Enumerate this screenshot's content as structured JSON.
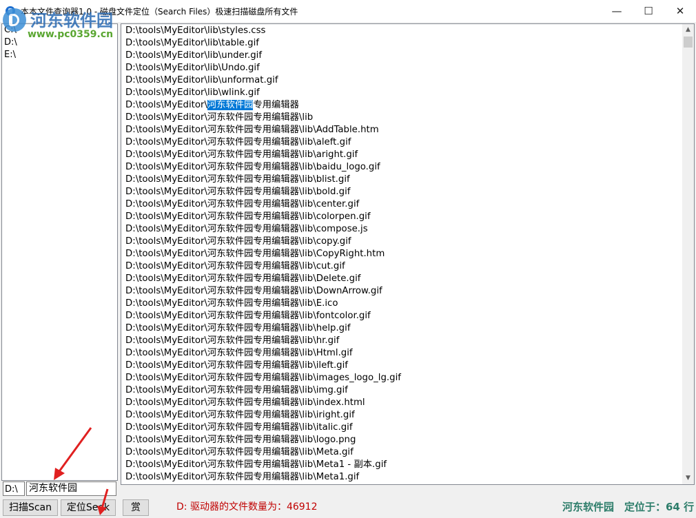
{
  "window": {
    "title": "本本文件查询器1.0 - 磁盘文件定位（Search Files）极速扫描磁盘所有文件",
    "minimize_label": "—",
    "maximize_label": "☐",
    "close_label": "✕"
  },
  "watermark": {
    "name": "河东软件园",
    "url": "www.pc0359.cn"
  },
  "drives": [
    "C:\\",
    "D:\\",
    "E:\\"
  ],
  "files": {
    "selected_text": "河东软件园",
    "rows": [
      "D:\\tools\\MyEditor\\lib\\styles.css",
      "D:\\tools\\MyEditor\\lib\\table.gif",
      "D:\\tools\\MyEditor\\lib\\under.gif",
      "D:\\tools\\MyEditor\\lib\\Undo.gif",
      "D:\\tools\\MyEditor\\lib\\unformat.gif",
      "D:\\tools\\MyEditor\\lib\\wlink.gif",
      "D:\\tools\\MyEditor\\河东软件园专用编辑器",
      "D:\\tools\\MyEditor\\河东软件园专用编辑器\\lib",
      "D:\\tools\\MyEditor\\河东软件园专用编辑器\\lib\\AddTable.htm",
      "D:\\tools\\MyEditor\\河东软件园专用编辑器\\lib\\aleft.gif",
      "D:\\tools\\MyEditor\\河东软件园专用编辑器\\lib\\aright.gif",
      "D:\\tools\\MyEditor\\河东软件园专用编辑器\\lib\\baidu_logo.gif",
      "D:\\tools\\MyEditor\\河东软件园专用编辑器\\lib\\blist.gif",
      "D:\\tools\\MyEditor\\河东软件园专用编辑器\\lib\\bold.gif",
      "D:\\tools\\MyEditor\\河东软件园专用编辑器\\lib\\center.gif",
      "D:\\tools\\MyEditor\\河东软件园专用编辑器\\lib\\colorpen.gif",
      "D:\\tools\\MyEditor\\河东软件园专用编辑器\\lib\\compose.js",
      "D:\\tools\\MyEditor\\河东软件园专用编辑器\\lib\\copy.gif",
      "D:\\tools\\MyEditor\\河东软件园专用编辑器\\lib\\CopyRight.htm",
      "D:\\tools\\MyEditor\\河东软件园专用编辑器\\lib\\cut.gif",
      "D:\\tools\\MyEditor\\河东软件园专用编辑器\\lib\\Delete.gif",
      "D:\\tools\\MyEditor\\河东软件园专用编辑器\\lib\\DownArrow.gif",
      "D:\\tools\\MyEditor\\河东软件园专用编辑器\\lib\\E.ico",
      "D:\\tools\\MyEditor\\河东软件园专用编辑器\\lib\\fontcolor.gif",
      "D:\\tools\\MyEditor\\河东软件园专用编辑器\\lib\\help.gif",
      "D:\\tools\\MyEditor\\河东软件园专用编辑器\\lib\\hr.gif",
      "D:\\tools\\MyEditor\\河东软件园专用编辑器\\lib\\Html.gif",
      "D:\\tools\\MyEditor\\河东软件园专用编辑器\\lib\\ileft.gif",
      "D:\\tools\\MyEditor\\河东软件园专用编辑器\\lib\\images_logo_lg.gif",
      "D:\\tools\\MyEditor\\河东软件园专用编辑器\\lib\\img.gif",
      "D:\\tools\\MyEditor\\河东软件园专用编辑器\\lib\\index.html",
      "D:\\tools\\MyEditor\\河东软件园专用编辑器\\lib\\iright.gif",
      "D:\\tools\\MyEditor\\河东软件园专用编辑器\\lib\\italic.gif",
      "D:\\tools\\MyEditor\\河东软件园专用编辑器\\lib\\logo.png",
      "D:\\tools\\MyEditor\\河东软件园专用编辑器\\lib\\Meta.gif",
      "D:\\tools\\MyEditor\\河东软件园专用编辑器\\lib\\Meta1 - 副本.gif",
      "D:\\tools\\MyEditor\\河东软件园专用编辑器\\lib\\Meta1.gif"
    ]
  },
  "search": {
    "drive_value": "D:\\",
    "keyword_value": "河东软件园"
  },
  "buttons": {
    "scan": "扫描Scan",
    "seek": "定位Seek",
    "reward": "赏"
  },
  "status": {
    "file_count": "D: 驱动器的文件数量为：46912",
    "brand": "河东软件园",
    "located": "定位于：64 行"
  },
  "colors": {
    "selection": "#0078d7",
    "status_count": "#c00000",
    "status_brand": "#2d7d6a",
    "arrow": "#e02020"
  }
}
